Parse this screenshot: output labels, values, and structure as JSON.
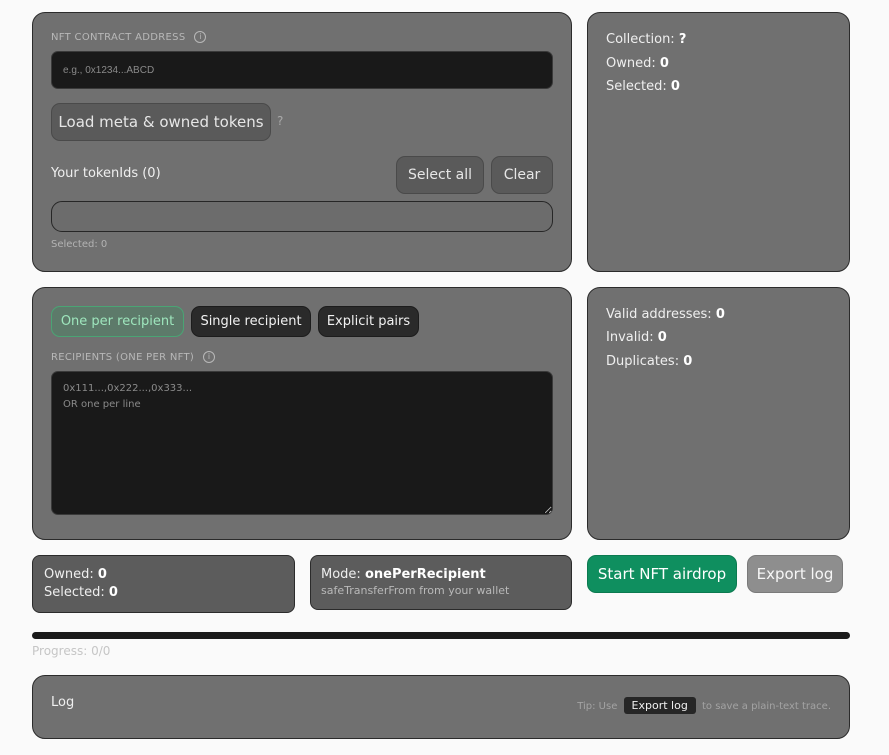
{
  "contract": {
    "label": "NFT CONTRACT ADDRESS",
    "info_glyph": "i",
    "placeholder": "e.g., 0x1234...ABCD",
    "load_button": "Load meta & owned tokens",
    "help_glyph": "?",
    "tokens_heading": "Your tokenIds (0)",
    "select_all": "Select all",
    "clear": "Clear",
    "selected_note": "Selected: 0"
  },
  "summary": {
    "collection_label": "Collection:",
    "collection_value": "?",
    "owned_label": "Owned:",
    "owned_value": "0",
    "selected_label": "Selected:",
    "selected_value": "0"
  },
  "recipients": {
    "modes": [
      "One per recipient",
      "Single recipient",
      "Explicit pairs"
    ],
    "active_mode_index": 0,
    "label": "RECIPIENTS (ONE PER NFT)",
    "info_glyph": "i",
    "placeholder": "0x111...,0x222...,0x333...\nOR one per line"
  },
  "validation": {
    "valid_label": "Valid addresses:",
    "valid_value": "0",
    "invalid_label": "Invalid:",
    "invalid_value": "0",
    "duplicates_label": "Duplicates:",
    "duplicates_value": "0"
  },
  "footer_stats": {
    "owned_label": "Owned:",
    "owned_value": "0",
    "selected_label": "Selected:",
    "selected_value": "0"
  },
  "mode_box": {
    "label": "Mode:",
    "value": "onePerRecipient",
    "sub": "safeTransferFrom from your wallet"
  },
  "actions": {
    "start": "Start NFT airdrop",
    "export": "Export log"
  },
  "progress": {
    "text": "Progress: 0/0",
    "fraction": 0
  },
  "log": {
    "title": "Log",
    "tip_prefix": "Tip: Use",
    "tip_key": "Export log",
    "tip_suffix": "to save a plain-text trace."
  },
  "colors": {
    "accent_green": "#0f8f5f",
    "active_mode_text": "#9ee6bd"
  }
}
